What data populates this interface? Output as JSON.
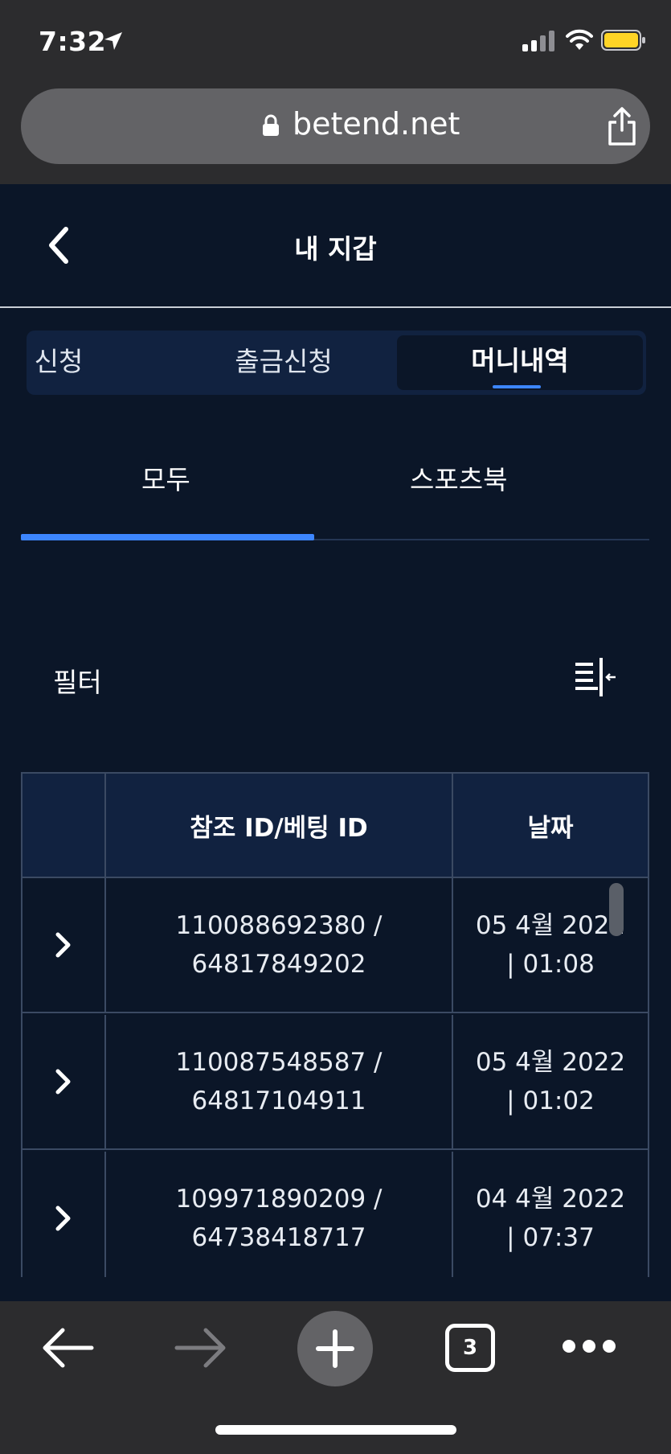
{
  "status_bar": {
    "time": "7:32"
  },
  "browser": {
    "url": "betend.net",
    "open_tabs": "3"
  },
  "header": {
    "title": "내 지갑"
  },
  "segment_tabs": [
    {
      "label": "신청"
    },
    {
      "label": "출금신청"
    },
    {
      "label": "머니내역",
      "active": true
    }
  ],
  "sub_tabs": [
    {
      "label": "모두",
      "active": true
    },
    {
      "label": "스포츠북"
    }
  ],
  "filter": {
    "label": "필터"
  },
  "table": {
    "headers": [
      "",
      "참조 ID/베팅 ID",
      "날짜"
    ],
    "rows": [
      {
        "ref": "110088692380 / 64817849202",
        "date": "05 4월 2022 | 01:08"
      },
      {
        "ref": "110087548587 / 64817104911",
        "date": "05 4월 2022 | 01:02"
      },
      {
        "ref": "109971890209 / 64738418717",
        "date": "04 4월 2022 | 07:37"
      }
    ]
  },
  "colors": {
    "background": "#0b1628",
    "accent": "#3d86ff",
    "header_bg": "#112240",
    "browser_chrome": "#2c2c2e"
  }
}
